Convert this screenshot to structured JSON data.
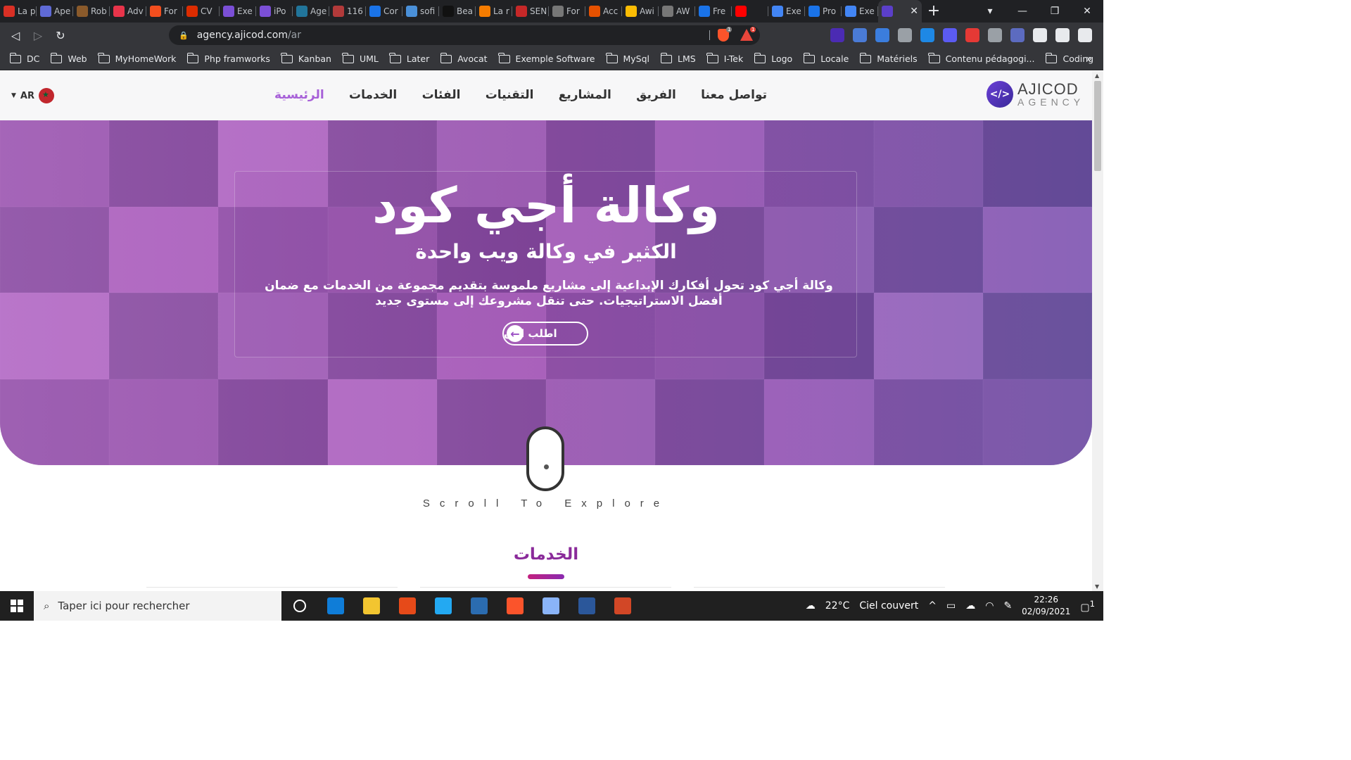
{
  "browser": {
    "tabs": [
      {
        "label": "La p",
        "color": "#d93025"
      },
      {
        "label": "Ape",
        "color": "#5f6ad6"
      },
      {
        "label": "Rob",
        "color": "#8a5a2b"
      },
      {
        "label": "Adv",
        "color": "#e8344a"
      },
      {
        "label": "For",
        "color": "#f24e1e"
      },
      {
        "label": "CV",
        "color": "#dd2c00"
      },
      {
        "label": "Exe",
        "color": "#7b4fd6"
      },
      {
        "label": "iPo",
        "color": "#7b4fd6"
      },
      {
        "label": "Age",
        "color": "#21759b"
      },
      {
        "label": "116",
        "color": "#b23a3a"
      },
      {
        "label": "Cor",
        "color": "#1a73e8"
      },
      {
        "label": "sofi",
        "color": "#4a90d9"
      },
      {
        "label": "Bea",
        "color": "#111111"
      },
      {
        "label": "La r",
        "color": "#f57c00"
      },
      {
        "label": "SEN",
        "color": "#c62828"
      },
      {
        "label": "For",
        "color": "#777777"
      },
      {
        "label": "Acc",
        "color": "#e65100"
      },
      {
        "label": "Awi",
        "color": "#fbbc04"
      },
      {
        "label": "AW",
        "color": "#777777"
      },
      {
        "label": "Fre",
        "color": "#1a73e8"
      },
      {
        "label": "",
        "color": "#ff0000"
      },
      {
        "label": "Exe",
        "color": "#4285f4"
      },
      {
        "label": "Pro",
        "color": "#1a73e8"
      },
      {
        "label": "Exe",
        "color": "#4285f4"
      },
      {
        "label": "",
        "color": "#5b3fc9",
        "active": true
      }
    ],
    "new_tab": "+",
    "url_host": "agency.ajicod.com",
    "url_path": "/ar",
    "shield_badge": "1",
    "rewards_badge": "1",
    "extension_colors": [
      "#4b2bb3",
      "#4a7bd6",
      "#3b7ddd",
      "#9aa0a6",
      "#1e88e5",
      "#5b5bf2",
      "#e53935",
      "#9aa0a6",
      "#5c6bc0",
      "#e8eaed",
      "#e8eaed",
      "#e8eaed"
    ],
    "bookmarks": [
      "DC",
      "Web",
      "MyHomeWork",
      "Php framworks",
      "Kanban",
      "UML",
      "Later",
      "Avocat",
      "Exemple Software",
      "MySql",
      "LMS",
      "I-Tek",
      "Logo",
      "Locale",
      "Matériels",
      "Contenu pédagogi...",
      "Coding"
    ],
    "bookmarks_more": "»"
  },
  "site": {
    "lang": "AR",
    "nav": [
      {
        "label": "الرئيسية",
        "active": true
      },
      {
        "label": "الخدمات"
      },
      {
        "label": "الفئات"
      },
      {
        "label": "التقنيات"
      },
      {
        "label": "المشاريع"
      },
      {
        "label": "الفريق"
      },
      {
        "label": "تواصل معنا"
      }
    ],
    "logo_mark": "</>",
    "logo_line1": "AJICOD",
    "logo_line2": "AGENCY",
    "hero": {
      "title": "وكالة أجي كود",
      "subtitle": "الكثير في وكالة ويب واحدة",
      "description": "وكالة أجي كود تحول أفكارك الإبداعية إلى مشاريع ملموسة بتقديم مجموعة من الخدمات مع ضمان أفضل الاستراتيجيات. حتى تنقل مشروعك إلى مستوى جديد",
      "cta": "اطلب الآن"
    },
    "scroll_text": "Scroll To Explore",
    "services_title": "الخدمات"
  },
  "taskbar": {
    "search_placeholder": "Taper ici pour rechercher",
    "app_colors": [
      "#ffffff",
      "#0f7dd8",
      "#f2c530",
      "#e64a19",
      "#23a9f2",
      "#2b6cb0",
      "#fb542b",
      "#8ab4f8",
      "#2b579a",
      "#d24726"
    ],
    "weather_temp": "22°C",
    "weather_desc": "Ciel couvert",
    "time": "22:26",
    "date": "02/09/2021",
    "notifications": "1"
  }
}
